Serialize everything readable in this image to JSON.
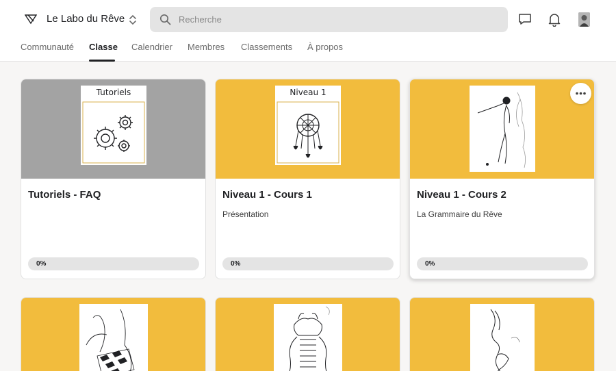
{
  "colors": {
    "accent": "#f2bc3d",
    "grey_cover": "#a3a3a3",
    "text": "#202124"
  },
  "header": {
    "group_name": "Le Labo du Rêve",
    "search_placeholder": "Recherche"
  },
  "tabs": [
    {
      "label": "Communauté",
      "active": false
    },
    {
      "label": "Classe",
      "active": true
    },
    {
      "label": "Calendrier",
      "active": false
    },
    {
      "label": "Membres",
      "active": false
    },
    {
      "label": "Classements",
      "active": false
    },
    {
      "label": "À propos",
      "active": false
    }
  ],
  "courses": [
    {
      "title": "Tutoriels - FAQ",
      "subtitle": "",
      "thumb_title": "Tutoriels",
      "progress": "0%",
      "progress_value": 0,
      "cover": "grey",
      "icon": "gears-icon"
    },
    {
      "title": "Niveau 1 - Cours 1",
      "subtitle": "Présentation",
      "thumb_title": "Niveau 1",
      "progress": "0%",
      "progress_value": 0,
      "cover": "yellow",
      "icon": "dreamcatcher-icon"
    },
    {
      "title": "Niveau 1 - Cours 2",
      "subtitle": "La Grammaire du Rêve",
      "thumb_title": "",
      "progress": "0%",
      "progress_value": 0,
      "cover": "yellow",
      "icon": "dancer-sketch-icon"
    }
  ],
  "courses_row2": [
    {
      "cover": "yellow",
      "icon": "chessboard-sketch-icon"
    },
    {
      "cover": "yellow",
      "icon": "throne-sketch-icon"
    },
    {
      "cover": "yellow",
      "icon": "mermaid-sketch-icon"
    }
  ]
}
